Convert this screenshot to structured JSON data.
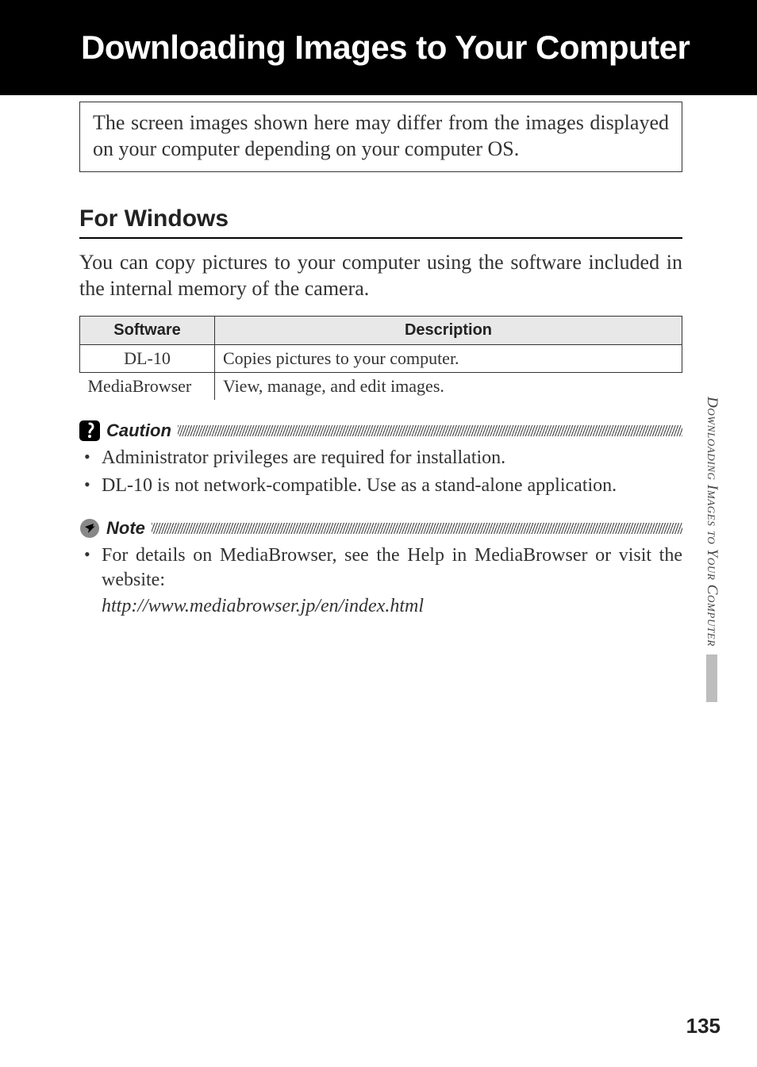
{
  "header": {
    "title": "Downloading Images to Your Computer"
  },
  "intro_box": "The screen images shown here may differ from the images displayed on your computer depending on your computer OS.",
  "section": {
    "heading": "For Windows",
    "intro": "You can copy pictures to your computer using the software included in the internal memory of the camera."
  },
  "table": {
    "headers": {
      "col1": "Software",
      "col2": "Description"
    },
    "rows": [
      {
        "name": "DL-10",
        "desc": "Copies pictures to your computer."
      },
      {
        "name": "MediaBrowser",
        "desc": "View, manage, and edit images."
      }
    ]
  },
  "caution": {
    "label": "Caution",
    "items": [
      "Administrator privileges are required for installation.",
      "DL-10 is not network-compatible. Use as a stand-alone application."
    ]
  },
  "note": {
    "label": "Note",
    "items": [
      "For details on MediaBrowser, see the Help in MediaBrowser or visit the website:"
    ],
    "url": "http://www.mediabrowser.jp/en/index.html"
  },
  "side_tab": "Downloading Images to Your Computer",
  "page_number": "135"
}
